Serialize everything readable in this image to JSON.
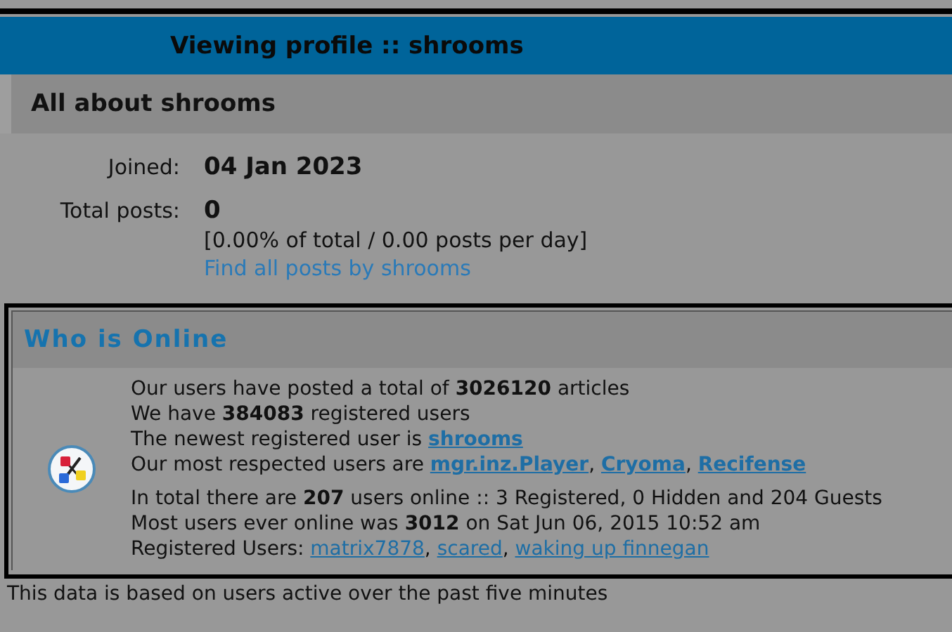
{
  "profile": {
    "title": "Viewing profile :: shrooms",
    "section_title": "All about shrooms",
    "fields": [
      {
        "label": "Joined:",
        "value": "04 Jan 2023"
      },
      {
        "label": "Total posts:",
        "value": "0",
        "lines": [
          {
            "kind": "text",
            "text": "[0.00% of total / 0.00 posts per day]"
          },
          {
            "kind": "link",
            "text": "Find all posts by shrooms"
          }
        ]
      }
    ]
  },
  "who_is_online": {
    "title": "Who is Online",
    "stats": [
      [
        {
          "kind": "text",
          "text": "Our users have posted a total of **3026120** articles"
        }
      ],
      [
        {
          "kind": "text",
          "text": "We have **384083** registered users"
        }
      ],
      [
        {
          "kind": "text",
          "text": "The newest registered user is "
        },
        {
          "kind": "strong-link",
          "text": "shrooms"
        }
      ],
      [
        {
          "kind": "text",
          "text": "Our most respected users are "
        },
        {
          "kind": "strong-link",
          "text": "mgr.inz.Player"
        },
        {
          "kind": "text",
          "text": ", "
        },
        {
          "kind": "strong-link",
          "text": "Cryoma"
        },
        {
          "kind": "text",
          "text": ", "
        },
        {
          "kind": "strong-link",
          "text": "Recifense"
        }
      ]
    ],
    "online": [
      [
        {
          "kind": "text",
          "text": "In total there are **207** users online :: 3 Registered, 0 Hidden and 204 Guests"
        }
      ],
      [
        {
          "kind": "text",
          "text": "Most users ever online was **3012** on Sat Jun 06, 2015 10:52 am"
        }
      ],
      [
        {
          "kind": "text",
          "text": "Registered Users: "
        },
        {
          "kind": "link",
          "text": "matrix7878"
        },
        {
          "kind": "text",
          "text": ", "
        },
        {
          "kind": "link",
          "text": "scared"
        },
        {
          "kind": "text",
          "text": ", "
        },
        {
          "kind": "link",
          "text": "waking up finnegan"
        }
      ]
    ]
  },
  "footer": "This data is based on users active over the past five minutes"
}
